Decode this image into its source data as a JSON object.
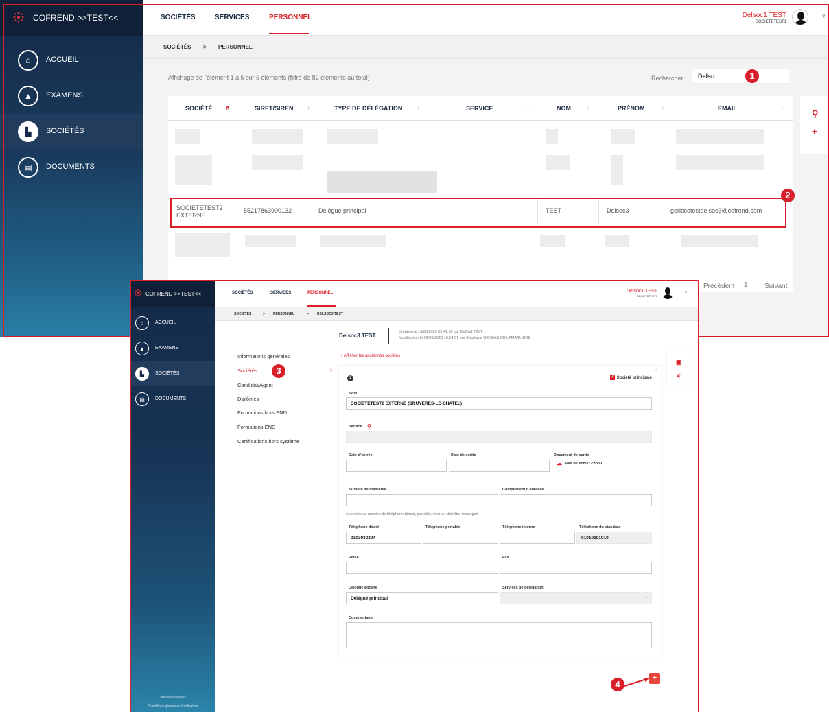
{
  "back": {
    "app_title": "COFREND >>TEST<<",
    "nav": [
      {
        "label": "ACCUEIL",
        "icon": "home-icon"
      },
      {
        "label": "EXAMENS",
        "icon": "graduation-cap-icon"
      },
      {
        "label": "SOCIÉTÉS",
        "icon": "factory-icon"
      },
      {
        "label": "DOCUMENTS",
        "icon": "book-icon"
      }
    ],
    "tabs": [
      "SOCIÉTÉS",
      "SERVICES",
      "PERSONNEL"
    ],
    "user": {
      "name": "Delsoc1 TEST",
      "org": "SOCIETETEST1"
    },
    "breadcrumb": [
      "SOCIÉTÉS",
      ">",
      "PERSONNEL"
    ],
    "info": "Affichage de l'élément 1 à 5 sur 5 éléments (filtré de 82 éléments au total)",
    "search": {
      "label": "Rechercher :",
      "value": "Delso"
    },
    "columns": [
      "SOCIÉTÉ",
      "SIRET/SIREN",
      "TYPE DE DÉLÉGATION",
      "SERVICE",
      "NOM",
      "PRÉNOM",
      "EMAIL"
    ],
    "highlighted_row": {
      "societe": "SOCIETETEST2 EXTERNE",
      "siret": "55217863900132",
      "type": "Délégué principal",
      "service": "",
      "nom": "TEST",
      "prenom": "Delsoc3",
      "email": "gericcotestdelsoc3@cofrend.com"
    },
    "pager": {
      "prev": "Précédent",
      "page": "1",
      "next": "Suivant"
    }
  },
  "front": {
    "app_title": "COFREND >>TEST<<",
    "nav": [
      "ACCUEIL",
      "EXAMENS",
      "SOCIÉTÉS",
      "DOCUMENTS"
    ],
    "tabs": [
      "SOCIÉTÉS",
      "SERVICES",
      "PERSONNEL"
    ],
    "user": {
      "name": "Delsoc1 TEST",
      "org": "SOCIETETEST1"
    },
    "breadcrumb": [
      "SOCIÉTÉS",
      ">",
      "PERSONNEL",
      ">",
      "DELSOC3 TEST"
    ],
    "person": "Delsoc3 TEST",
    "creation": "Création le 19/08/2025 09:41:18 par Del2nd TEST",
    "modification": "Modification le 02/09/2025 16:14:51 par Stéphane GENEAU DE LAMARLIERE",
    "menu": [
      "Informations générales",
      "Sociétés",
      "Candidat/Agent",
      "Diplômes",
      "Formations hors END",
      "Formations END",
      "Certifications hors système"
    ],
    "show_old": "+ Afficher les anciennes sociétés",
    "card": {
      "index": "1",
      "principal": "Société principale",
      "nom_label": "Nom",
      "nom_value": "SOCIETETEST2 EXTERNE (BRUYERES-LE-CHATEL)",
      "service_label": "Service",
      "date_entree": "Date d'entrée",
      "date_sortie": "Date de sortie",
      "doc_sortie": "Document de sortie",
      "no_file": "Pas de fichier choisi",
      "matricule": "Numéro de matricule",
      "complement": "Complément d'adresse",
      "phone_note": "Au moins un numéro de téléphone (direct, portable, interne) doit être renseigné",
      "tel_direct": "Téléphone direct",
      "tel_direct_value": "0303030304",
      "tel_portable": "Téléphone portable",
      "tel_interne": "Téléphone interne",
      "tel_standard": "Téléphone du standard",
      "tel_standard_value": "01010101010",
      "email": "Email",
      "fax": "Fax",
      "delegue_label": "Délégué société",
      "delegue_value": "Délégué principal",
      "services_deleg": "Services de délégation",
      "commentaire": "Commentaire"
    },
    "legal": [
      "Mentions légales",
      "Conditions générales d'utilisation"
    ]
  },
  "callouts": [
    "1",
    "2",
    "3",
    "4"
  ],
  "colors": {
    "accent": "#d9202a",
    "sidebar": "#142a48"
  }
}
